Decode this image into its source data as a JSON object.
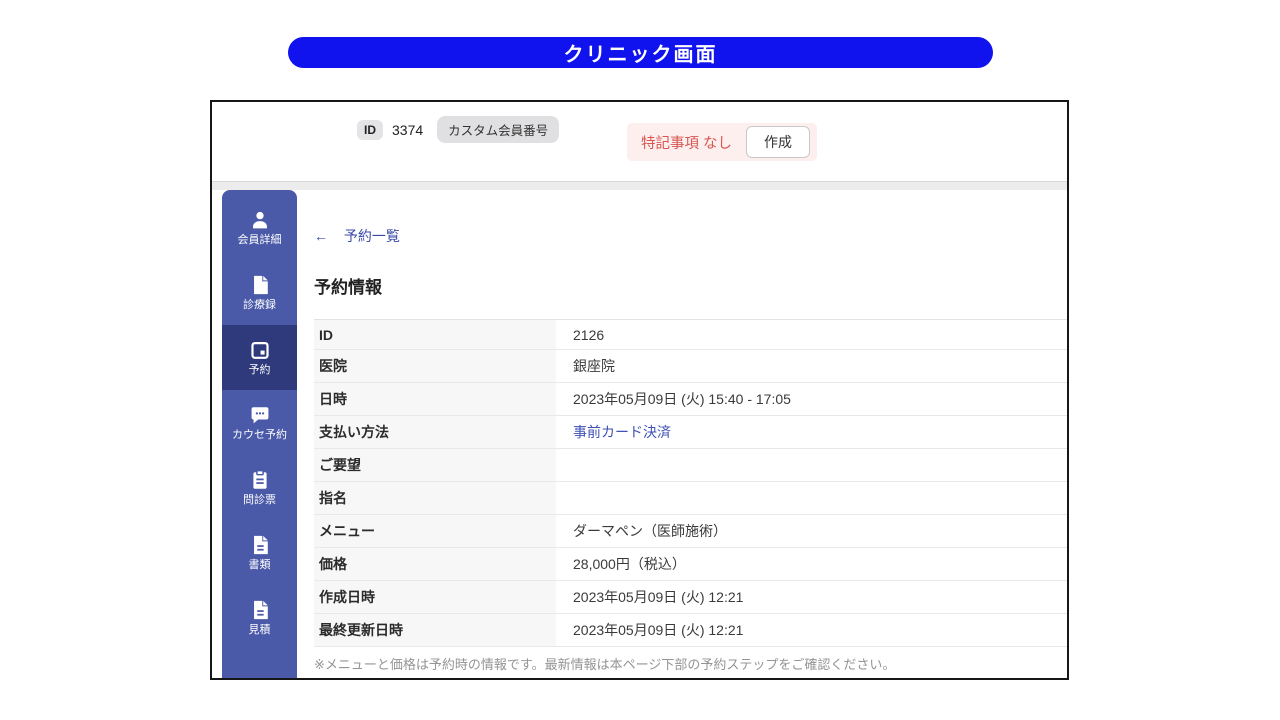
{
  "banner": {
    "title": "クリニック画面"
  },
  "header": {
    "id_label": "ID",
    "id_value": "3374",
    "custom_member_badge": "カスタム会員番号",
    "notes_label": "特記事項",
    "notes_value": "なし",
    "create_button": "作成"
  },
  "sidebar": {
    "items": [
      {
        "label": "会員詳細",
        "icon": "person-icon",
        "active": false
      },
      {
        "label": "診療録",
        "icon": "file-icon",
        "active": false
      },
      {
        "label": "予約",
        "icon": "calendar-icon",
        "active": true
      },
      {
        "label": "カウセ予約",
        "icon": "chat-icon",
        "active": false
      },
      {
        "label": "問診票",
        "icon": "clipboard-icon",
        "active": false
      },
      {
        "label": "書類",
        "icon": "document-icon",
        "active": false
      },
      {
        "label": "見積",
        "icon": "document-icon",
        "active": false
      }
    ]
  },
  "main": {
    "back_link": "予約一覧",
    "title": "予約情報",
    "table": {
      "rows": [
        {
          "label": "ID",
          "value": "2126",
          "link": false
        },
        {
          "label": "医院",
          "value": "銀座院",
          "link": false
        },
        {
          "label": "日時",
          "value": "2023年05月09日 (火) 15:40 - 17:05",
          "link": false
        },
        {
          "label": "支払い方法",
          "value": "事前カード決済",
          "link": true
        },
        {
          "label": "ご要望",
          "value": "",
          "link": false
        },
        {
          "label": "指名",
          "value": "",
          "link": false
        },
        {
          "label": "メニュー",
          "value": "ダーマペン（医師施術）",
          "link": false
        },
        {
          "label": "価格",
          "value": "28,000円（税込）",
          "link": false
        },
        {
          "label": "作成日時",
          "value": "2023年05月09日 (火) 12:21",
          "link": false
        },
        {
          "label": "最終更新日時",
          "value": "2023年05月09日 (火) 12:21",
          "link": false
        }
      ]
    },
    "footnote": "※メニューと価格は予約時の情報です。最新情報は本ページ下部の予約ステップをご確認ください。"
  },
  "colors": {
    "banner_blue": "#1113ee",
    "sidebar_blue": "#4a59a8",
    "sidebar_active_blue": "#2e3a7c",
    "link_indigo": "#3f51b5",
    "alert_red": "#d95552",
    "alert_bg_pink": "#fcefed"
  }
}
